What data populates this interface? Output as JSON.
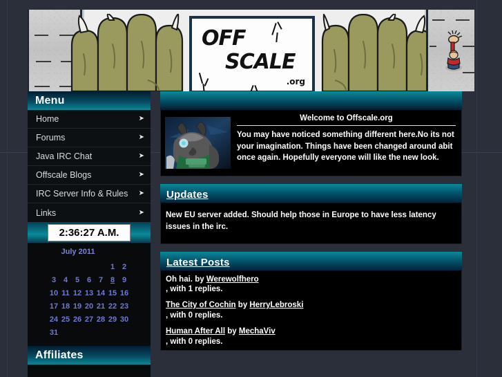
{
  "banner": {
    "logo_line1": "OFF",
    "logo_line2": "SCALE",
    "logo_suffix": ".org",
    "alt": "offscale-banner"
  },
  "sidebar": {
    "menu_title": "Menu",
    "items": [
      {
        "label": "Home",
        "arrow": "chevron-right-icon"
      },
      {
        "label": "Forums",
        "arrow": "chevron-right-icon"
      },
      {
        "label": "Java IRC Chat",
        "arrow": "chevron-right-icon"
      },
      {
        "label": "Offscale Blogs",
        "arrow": "chevron-right-icon"
      },
      {
        "label": "IRC Server Info & Rules",
        "arrow": "chevron-right-icon"
      },
      {
        "label": "Links",
        "arrow": "chevron-right-icon"
      }
    ],
    "clock": "2:36:27 A.M.",
    "calendar": {
      "title": "July 2011",
      "today": "8",
      "weeks": [
        [
          "",
          "",
          "",
          "",
          "",
          "1",
          "2"
        ],
        [
          "3",
          "4",
          "5",
          "6",
          "7",
          "8",
          "9"
        ],
        [
          "10",
          "11",
          "12",
          "13",
          "14",
          "15",
          "16"
        ],
        [
          "17",
          "18",
          "19",
          "20",
          "21",
          "22",
          "23"
        ],
        [
          "24",
          "25",
          "26",
          "27",
          "28",
          "29",
          "30"
        ],
        [
          "31",
          "",
          "",
          "",
          "",
          "",
          ""
        ]
      ]
    },
    "affiliates_title": "Affiliates"
  },
  "content": {
    "welcome": {
      "title": "Welcome to Offscale.org",
      "body": "You may have noticed something different here.No its not your imagination. Things have been changed around abit once again. Hopefully everyone will like the new look.",
      "avatar_name": "werewolf-avatar"
    },
    "updates": {
      "title": "Updates",
      "body": "New EU server added. Should help those in Europe to have less latency issues in the irc."
    },
    "posts": {
      "title": "Latest Posts",
      "by_label": "by",
      "items": [
        {
          "title": "Oh hai.",
          "title_is_link": false,
          "author": "Werewolfhero",
          "meta": ", with 1 replies."
        },
        {
          "title": "The City of Cochin",
          "title_is_link": true,
          "author": "HerryLebroski",
          "meta": ", with 0 replies."
        },
        {
          "title": "Human After All",
          "title_is_link": true,
          "author": "MechaViv",
          "meta": ", with 0 replies."
        }
      ]
    }
  },
  "colors": {
    "accent_teal": "#0a8b99",
    "header_dark": "#021d2f",
    "page_bg": "#2b2f3a",
    "panel_black": "#000000",
    "link_blue": "#6f7ad0"
  }
}
